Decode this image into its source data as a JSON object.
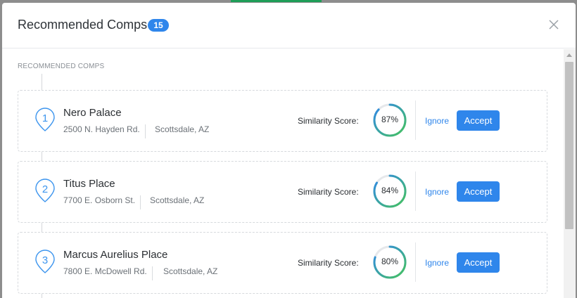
{
  "modal": {
    "title": "Recommended Comps",
    "count_badge": "15",
    "close_icon": "close-icon"
  },
  "section_label": "RECOMMENDED COMPS",
  "colors": {
    "accent": "#2f86eb",
    "ring_green": "#45c35c",
    "ring_blue": "#2f86eb",
    "ring_track": "#e6e8eb"
  },
  "comps": [
    {
      "number": "1",
      "name": "Nero Palace",
      "street": "2500 N. Hayden Rd.",
      "city": "Scottsdale, AZ",
      "score_label": "Similarity Score:",
      "score_value": 87,
      "score_text": "87%",
      "ignore_label": "Ignore",
      "accept_label": "Accept"
    },
    {
      "number": "2",
      "name": "Titus Place",
      "street": "7700 E. Osborn St.",
      "city": "Scottsdale, AZ",
      "score_label": "Similarity Score:",
      "score_value": 84,
      "score_text": "84%",
      "ignore_label": "Ignore",
      "accept_label": "Accept"
    },
    {
      "number": "3",
      "name": "Marcus Aurelius Place",
      "street": "7800 E. McDowell Rd.",
      "city": "Scottsdale, AZ",
      "score_label": "Similarity Score:",
      "score_value": 80,
      "score_text": "80%",
      "ignore_label": "Ignore",
      "accept_label": "Accept"
    }
  ]
}
